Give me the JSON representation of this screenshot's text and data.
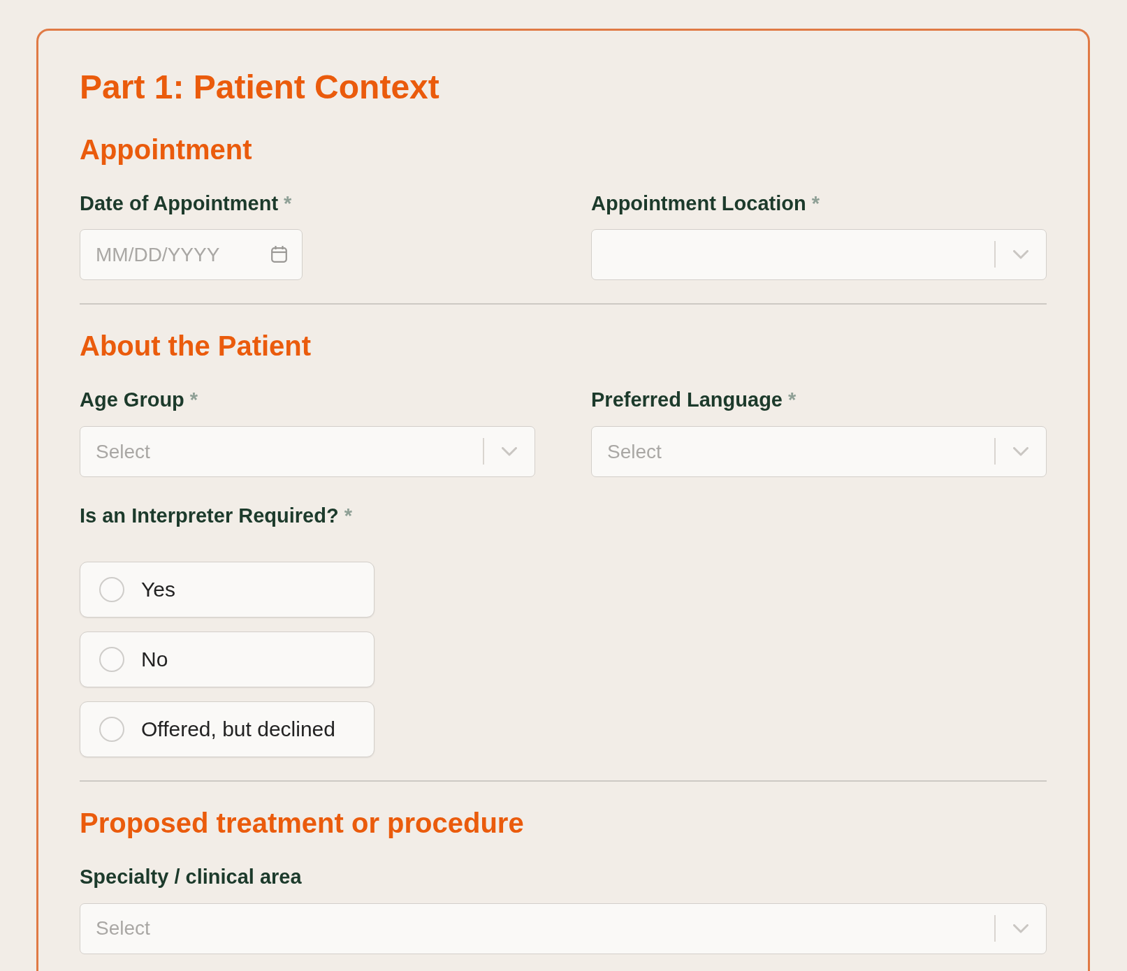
{
  "title": "Part 1: Patient Context",
  "sections": [
    {
      "heading": "Appointment",
      "rows": [
        {
          "fields": [
            {
              "kind": "date",
              "label": "Date of Appointment",
              "required_mark": "*",
              "placeholder": "MM/DD/YYYY"
            },
            {
              "kind": "select",
              "label": "Appointment Location",
              "required_mark": "*"
            }
          ]
        }
      ]
    },
    {
      "heading": "About the Patient",
      "rows": [
        {
          "fields": [
            {
              "kind": "select",
              "label": "Age Group",
              "required_mark": "*",
              "placeholder": "Select"
            },
            {
              "kind": "select",
              "label": "Preferred Language",
              "required_mark": "*",
              "placeholder": "Select"
            }
          ]
        },
        {
          "fields": [
            {
              "kind": "radio",
              "label": "Is an Interpreter Required?",
              "required_mark": "*",
              "options": [
                {
                  "label": "Yes",
                  "selected": false
                },
                {
                  "label": "No",
                  "selected": false
                },
                {
                  "label": "Offered, but declined",
                  "selected": false
                }
              ]
            }
          ]
        }
      ]
    },
    {
      "heading": "Proposed treatment or procedure",
      "rows": [
        {
          "fields": [
            {
              "kind": "select",
              "label": "Specialty / clinical area",
              "placeholder": "Select"
            }
          ]
        }
      ]
    }
  ]
}
